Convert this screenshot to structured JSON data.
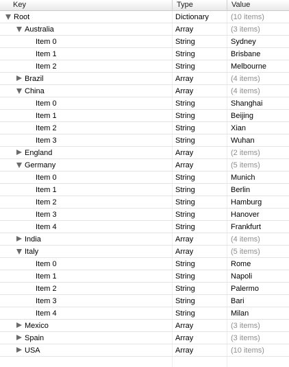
{
  "header": {
    "key": "Key",
    "type": "Type",
    "value": "Value"
  },
  "rows": [
    {
      "key": "Root",
      "type": "Dictionary",
      "value": "(10 items)",
      "level": 0,
      "expander": "down",
      "muted": true
    },
    {
      "key": "Australia",
      "type": "Array",
      "value": "(3 items)",
      "level": 1,
      "expander": "down",
      "muted": true
    },
    {
      "key": "Item 0",
      "type": "String",
      "value": "Sydney",
      "level": 2,
      "expander": "none",
      "muted": false
    },
    {
      "key": "Item 1",
      "type": "String",
      "value": "Brisbane",
      "level": 2,
      "expander": "none",
      "muted": false
    },
    {
      "key": "Item 2",
      "type": "String",
      "value": "Melbourne",
      "level": 2,
      "expander": "none",
      "muted": false
    },
    {
      "key": "Brazil",
      "type": "Array",
      "value": "(4 items)",
      "level": 1,
      "expander": "right",
      "muted": true
    },
    {
      "key": "China",
      "type": "Array",
      "value": "(4 items)",
      "level": 1,
      "expander": "down",
      "muted": true
    },
    {
      "key": "Item 0",
      "type": "String",
      "value": "Shanghai",
      "level": 2,
      "expander": "none",
      "muted": false
    },
    {
      "key": "Item 1",
      "type": "String",
      "value": "Beijing",
      "level": 2,
      "expander": "none",
      "muted": false
    },
    {
      "key": "Item 2",
      "type": "String",
      "value": "Xian",
      "level": 2,
      "expander": "none",
      "muted": false
    },
    {
      "key": "Item 3",
      "type": "String",
      "value": "Wuhan",
      "level": 2,
      "expander": "none",
      "muted": false
    },
    {
      "key": "England",
      "type": "Array",
      "value": "(2 items)",
      "level": 1,
      "expander": "right",
      "muted": true
    },
    {
      "key": "Germany",
      "type": "Array",
      "value": "(5 items)",
      "level": 1,
      "expander": "down",
      "muted": true
    },
    {
      "key": "Item 0",
      "type": "String",
      "value": "Munich",
      "level": 2,
      "expander": "none",
      "muted": false
    },
    {
      "key": "Item 1",
      "type": "String",
      "value": "Berlin",
      "level": 2,
      "expander": "none",
      "muted": false
    },
    {
      "key": "Item 2",
      "type": "String",
      "value": "Hamburg",
      "level": 2,
      "expander": "none",
      "muted": false
    },
    {
      "key": "Item 3",
      "type": "String",
      "value": "Hanover",
      "level": 2,
      "expander": "none",
      "muted": false
    },
    {
      "key": "Item 4",
      "type": "String",
      "value": "Frankfurt",
      "level": 2,
      "expander": "none",
      "muted": false
    },
    {
      "key": "India",
      "type": "Array",
      "value": "(4 items)",
      "level": 1,
      "expander": "right",
      "muted": true
    },
    {
      "key": "Italy",
      "type": "Array",
      "value": "(5 items)",
      "level": 1,
      "expander": "down",
      "muted": true
    },
    {
      "key": "Item 0",
      "type": "String",
      "value": "Rome",
      "level": 2,
      "expander": "none",
      "muted": false
    },
    {
      "key": "Item 1",
      "type": "String",
      "value": "Napoli",
      "level": 2,
      "expander": "none",
      "muted": false
    },
    {
      "key": "Item 2",
      "type": "String",
      "value": "Palermo",
      "level": 2,
      "expander": "none",
      "muted": false
    },
    {
      "key": "Item 3",
      "type": "String",
      "value": "Bari",
      "level": 2,
      "expander": "none",
      "muted": false
    },
    {
      "key": "Item 4",
      "type": "String",
      "value": "Milan",
      "level": 2,
      "expander": "none",
      "muted": false
    },
    {
      "key": "Mexico",
      "type": "Array",
      "value": "(3 items)",
      "level": 1,
      "expander": "right",
      "muted": true
    },
    {
      "key": "Spain",
      "type": "Array",
      "value": "(3 items)",
      "level": 1,
      "expander": "right",
      "muted": true
    },
    {
      "key": "USA",
      "type": "Array",
      "value": "(10 items)",
      "level": 1,
      "expander": "right",
      "muted": true
    }
  ]
}
